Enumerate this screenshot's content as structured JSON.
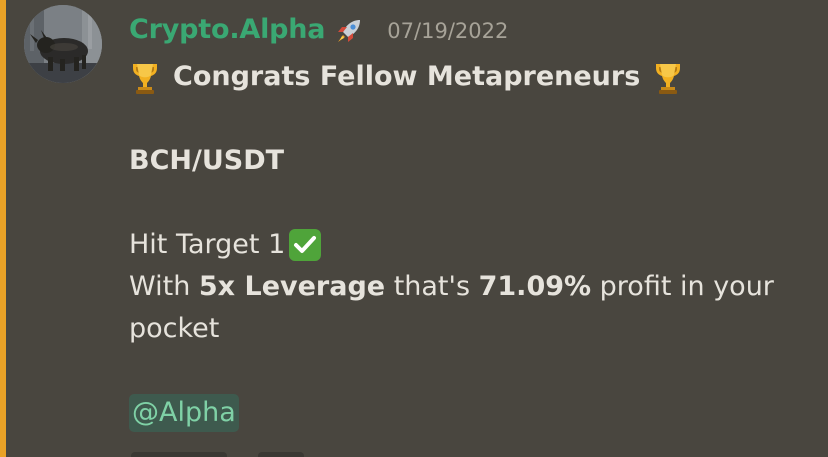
{
  "message": {
    "author": "Crypto.Alpha",
    "author_badge_icon": "rocket-icon",
    "timestamp": "07/19/2022",
    "headline": "Congrats Fellow Metapreneurs",
    "pair": "BCH/USDT",
    "target_text": "Hit Target 1",
    "leverage_prefix": "With ",
    "leverage": "5x Leverage",
    "leverage_mid": " that's ",
    "profit": "71.09%",
    "leverage_suffix": " profit in your pocket",
    "mention": "@Alpha"
  },
  "colors": {
    "background": "#49463f",
    "accent_bar": "#e9a227",
    "username": "#3aa873",
    "timestamp": "#a7a398",
    "text": "#e6e3dc",
    "mention_bg": "#3e5a4e",
    "mention_text": "#7fd1a6",
    "check": "#4fa43a"
  }
}
